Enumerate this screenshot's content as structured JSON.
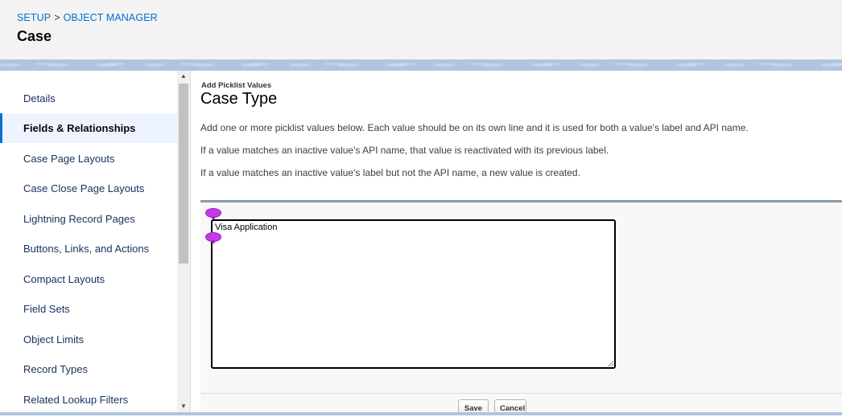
{
  "header": {
    "breadcrumb": [
      "SETUP",
      "OBJECT MANAGER"
    ],
    "breadcrumb_separator": ">",
    "title": "Case"
  },
  "sidebar": {
    "items": [
      {
        "label": "Details",
        "active": false
      },
      {
        "label": "Fields & Relationships",
        "active": true
      },
      {
        "label": "Case Page Layouts",
        "active": false
      },
      {
        "label": "Case Close Page Layouts",
        "active": false
      },
      {
        "label": "Lightning Record Pages",
        "active": false
      },
      {
        "label": "Buttons, Links, and Actions",
        "active": false
      },
      {
        "label": "Compact Layouts",
        "active": false
      },
      {
        "label": "Field Sets",
        "active": false
      },
      {
        "label": "Object Limits",
        "active": false
      },
      {
        "label": "Record Types",
        "active": false
      },
      {
        "label": "Related Lookup Filters",
        "active": false
      }
    ]
  },
  "scrollbar": {
    "up_icon": "▲",
    "down_icon": "▼"
  },
  "main": {
    "sub_title": "Add Picklist Values",
    "title": "Case Type",
    "descriptions": [
      "Add one or more picklist values below. Each value should be on its own line and it is used for both a value's label and API name.",
      "If a value matches an inactive value's API name, that value is reactivated with its previous label.",
      "If a value matches an inactive value's label but not the API name, a new value is created."
    ],
    "textarea_value": "Visa Application",
    "save_label": "Save",
    "cancel_label": "Cancel"
  },
  "colors": {
    "link": "#0070d2",
    "active_bg": "#eef4ff",
    "pin": "#c23be6",
    "band": "#b0c4df"
  }
}
